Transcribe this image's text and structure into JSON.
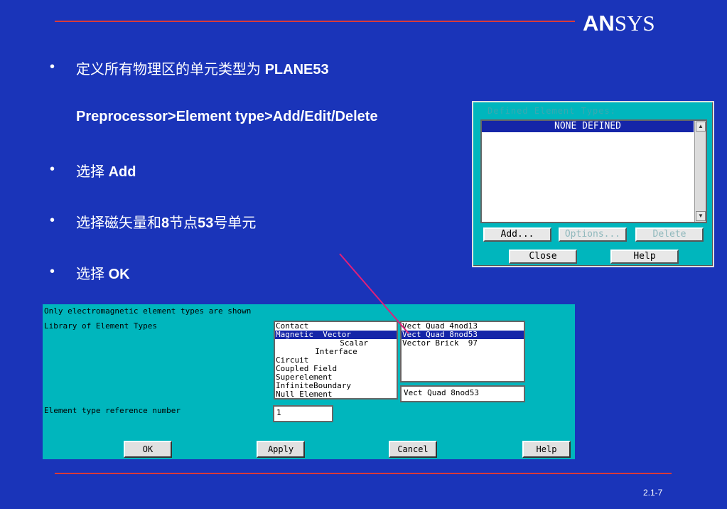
{
  "slide": {
    "logo_bold": "AN",
    "logo_rest": "SYS",
    "page_number": "2.1-7",
    "bullets": [
      {
        "marker": "•",
        "text_a": "定义所有物理区的单元类型为 ",
        "text_b": "PLANE53"
      },
      {
        "text_b": "Preprocessor>Element type>Add/Edit/Delete"
      },
      {
        "marker": "•",
        "text_a": "选择  ",
        "text_b": "Add"
      },
      {
        "marker": "•",
        "text_a": "选择磁矢量和",
        "text_b": "8",
        "text_c": "节点",
        "text_d": "53",
        "text_e": "号单元"
      },
      {
        "marker": "•",
        "text_a": "选择 ",
        "text_b": "OK"
      }
    ],
    "accent_color": "#d83a3a",
    "background_color": "#1a34b9"
  },
  "defined_dialog": {
    "title": "Defined Element Types:",
    "list_item": "NONE DEFINED",
    "buttons": {
      "add": "Add...",
      "options": "Options...",
      "delete": "Delete",
      "close": "Close",
      "help": "Help"
    }
  },
  "library_dialog": {
    "note": "Only electromagnetic element types are shown",
    "library_label": "Library of Element Types",
    "categories": [
      "Contact",
      "Magnetic  Vector",
      "Scalar",
      "Interface",
      "Circuit",
      "Coupled Field",
      "Superelement",
      "InfiniteBoundary",
      "Null Element"
    ],
    "selected_category": 1,
    "elements": [
      "Vect Quad 4nod13",
      "Vect Quad 8nod53",
      "Vector Brick  97"
    ],
    "selected_element": 1,
    "selection_value": "Vect Quad 8nod53",
    "ref_label": "Element type reference number",
    "ref_value": "1",
    "buttons": {
      "ok": "OK",
      "apply": "Apply",
      "cancel": "Cancel",
      "help": "Help"
    }
  }
}
